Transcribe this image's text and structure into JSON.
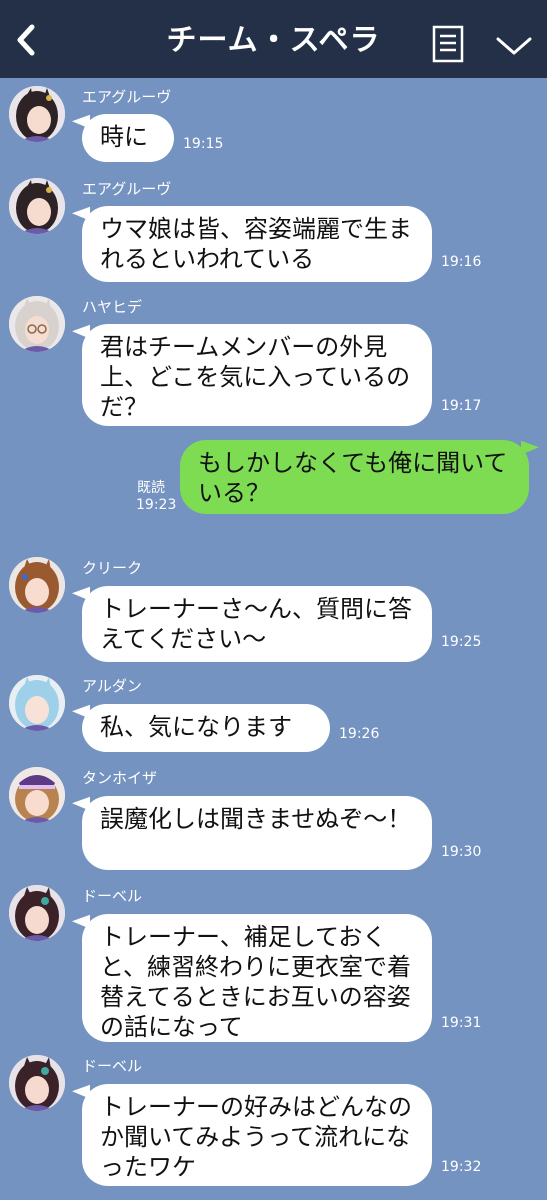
{
  "header": {
    "title": "チーム・スペラ",
    "back_icon": "chevron-left-icon",
    "notes_icon": "notes-icon",
    "menu_icon": "chevron-down-icon"
  },
  "colors": {
    "header_bg": "#233047",
    "chat_bg": "#7493c1",
    "incoming_bubble": "#ffffff",
    "outgoing_bubble": "#7edc52"
  },
  "messages": [
    {
      "sender": "エアグルーヴ",
      "text": "時に",
      "time": "19:15"
    },
    {
      "sender": "エアグルーヴ",
      "text": "ウマ娘は皆、容姿端麗で生まれるといわれている",
      "time": "19:16"
    },
    {
      "sender": "ハヤヒデ",
      "text": "君はチームメンバーの外見上、どこを気に入っているのだ？",
      "time": "19:17"
    },
    {
      "sender": "",
      "text": "もしかしなくても俺に聞いている？",
      "time": "19:23",
      "read": "既読"
    },
    {
      "sender": "クリーク",
      "text": "トレーナーさ〜ん、質問に答えてください〜",
      "time": "19:25"
    },
    {
      "sender": "アルダン",
      "text": "私、気になります",
      "time": "19:26"
    },
    {
      "sender": "タンホイザ",
      "text": "誤魔化しは聞きませぬぞ〜！",
      "time": "19:30"
    },
    {
      "sender": "ドーベル",
      "text": "トレーナー、補足しておくと、練習終わりに更衣室で着替えてるときにお互いの容姿の話になって",
      "time": "19:31"
    },
    {
      "sender": "ドーベル",
      "text": "トレーナーの好みはどんなのか聞いてみようって流れになったワケ",
      "time": "19:32"
    }
  ]
}
